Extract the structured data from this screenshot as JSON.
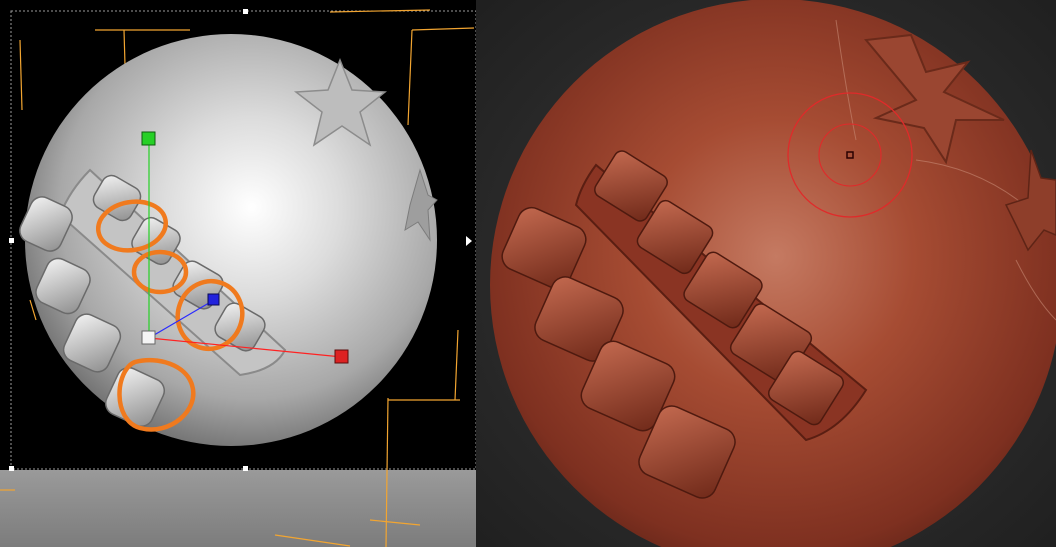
{
  "left_viewport": {
    "background_color": "#000000",
    "floor_color": "#8a8a8a",
    "sphere_color": "#d6d6d6",
    "grid_line_color": "#f2a531",
    "highlight_color": "#f07a1e",
    "gizmo": {
      "y_axis_color": "#26d026",
      "z_axis_color": "#2222dd",
      "x_axis_color": "#dd2222",
      "pivot_color": "#f4f4f4"
    },
    "highlight_markers": 4,
    "teeth_count": 8,
    "star_count": 2
  },
  "right_viewport": {
    "background_color": "#2c2c2c",
    "clay_color": "#a44a33",
    "brush_cursor_color": "#e02a2a",
    "teeth_count": 9,
    "star_count": 2
  }
}
